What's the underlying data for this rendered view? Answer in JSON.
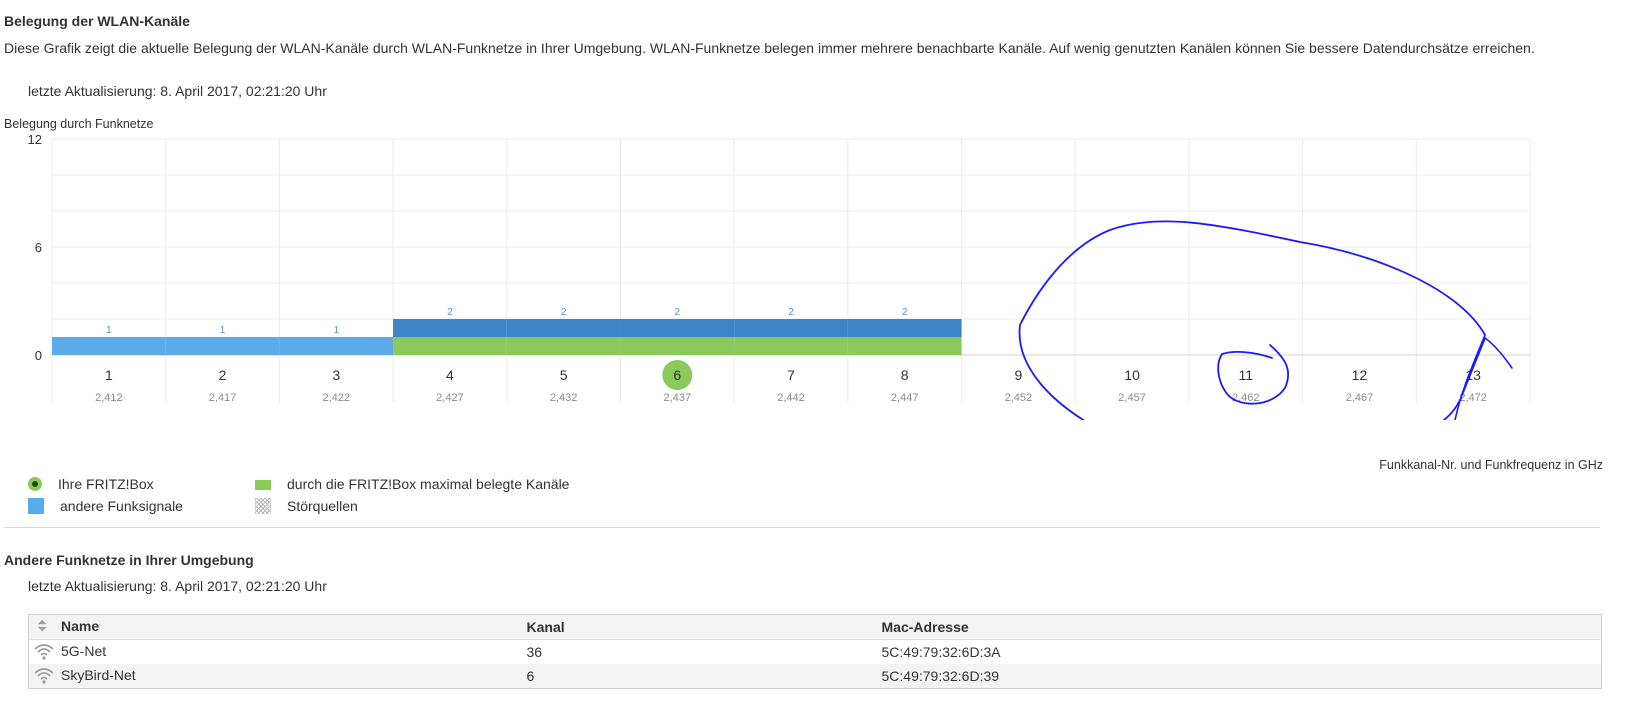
{
  "header": {
    "title": "Belegung der WLAN-Kanäle",
    "description": "Diese Grafik zeigt die aktuelle Belegung der WLAN-Kanäle durch WLAN-Funknetze in Ihrer Umgebung. WLAN-Funknetze belegen immer mehrere benachbarte Kanäle. Auf wenig genutzten Kanälen können Sie bessere Datendurchsätze erreichen.",
    "last_update": "letzte Aktualisierung: 8. April 2017, 02:21:20 Uhr"
  },
  "chart_data": {
    "type": "bar",
    "title": "Belegung durch Funknetze",
    "xlabel": "Funkkanal-Nr. und Funkfrequenz in GHz",
    "ylabel": "",
    "ylim": [
      0,
      12
    ],
    "yticks": [
      0,
      6,
      12
    ],
    "categories": [
      "1",
      "2",
      "3",
      "4",
      "5",
      "6",
      "7",
      "8",
      "9",
      "10",
      "11",
      "12",
      "13"
    ],
    "frequencies": [
      "2,412",
      "2,417",
      "2,422",
      "2,427",
      "2,432",
      "2,437",
      "2,442",
      "2,447",
      "2,452",
      "2,457",
      "2,462",
      "2,467",
      "2,472"
    ],
    "series": [
      {
        "name": "andere Funksignale",
        "color": "#5aabe8",
        "values": [
          1,
          1,
          1,
          1,
          1,
          1,
          1,
          1,
          0,
          0,
          0,
          0,
          0
        ]
      },
      {
        "name": "durch die FRITZ!Box maximal belegte Kanäle",
        "color": "#8bc95a",
        "values": [
          0,
          0,
          0,
          1,
          1,
          1,
          1,
          1,
          0,
          0,
          0,
          0,
          0
        ]
      }
    ],
    "overlay_color": "#3d85c6",
    "total_labels": [
      "1",
      "1",
      "1",
      "2",
      "2",
      "2",
      "2",
      "2",
      "",
      "",
      "",
      "",
      ""
    ],
    "fritzbox_channel": "6",
    "grid": true,
    "annotation": "hand-drawn blue circle around channels 9-13"
  },
  "legend": {
    "fritzbox": "Ihre FRITZ!Box",
    "max_channels": "durch die FRITZ!Box maximal belegte Kanäle",
    "other_signals": "andere Funksignale",
    "noise": "Störquellen"
  },
  "networks": {
    "title": "Andere Funknetze in Ihrer Umgebung",
    "last_update": "letzte Aktualisierung: 8. April 2017, 02:21:20 Uhr",
    "columns": [
      "Name",
      "Kanal",
      "Mac-Adresse"
    ],
    "rows": [
      {
        "name": "5G-Net",
        "channel": "36",
        "mac": "5C:49:79:32:6D:3A",
        "icon": "wifi-signal-icon"
      },
      {
        "name": "SkyBird-Net",
        "channel": "6",
        "mac": "5C:49:79:32:6D:39",
        "icon": "wifi-signal-icon"
      }
    ]
  },
  "colors": {
    "blue_light": "#5aabe8",
    "blue_dark": "#3d85c6",
    "green": "#8bc95a",
    "annotation": "#1a1aff"
  }
}
